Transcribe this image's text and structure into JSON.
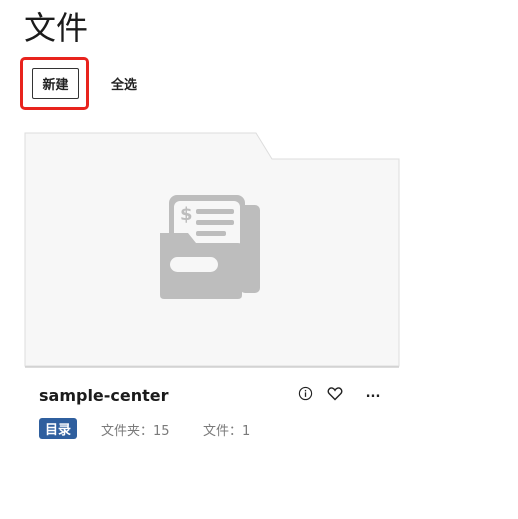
{
  "page": {
    "title": "文件"
  },
  "toolbar": {
    "new_label": "新建",
    "select_all_label": "全选"
  },
  "item": {
    "name": "sample-center",
    "tag": "目录",
    "folders_text": "文件夹：15",
    "files_text": "文件：1",
    "actions": {
      "more_label": "..."
    }
  },
  "icons": [
    "info-icon",
    "heart-icon",
    "more-icon",
    "folder-thumbnail",
    "document-invoice-icon"
  ],
  "colors": {
    "accent": "#2f5f9e",
    "highlight": "#e8231d",
    "thumb_bg": "#f7f7f7",
    "icon": "#bdbdbd"
  }
}
